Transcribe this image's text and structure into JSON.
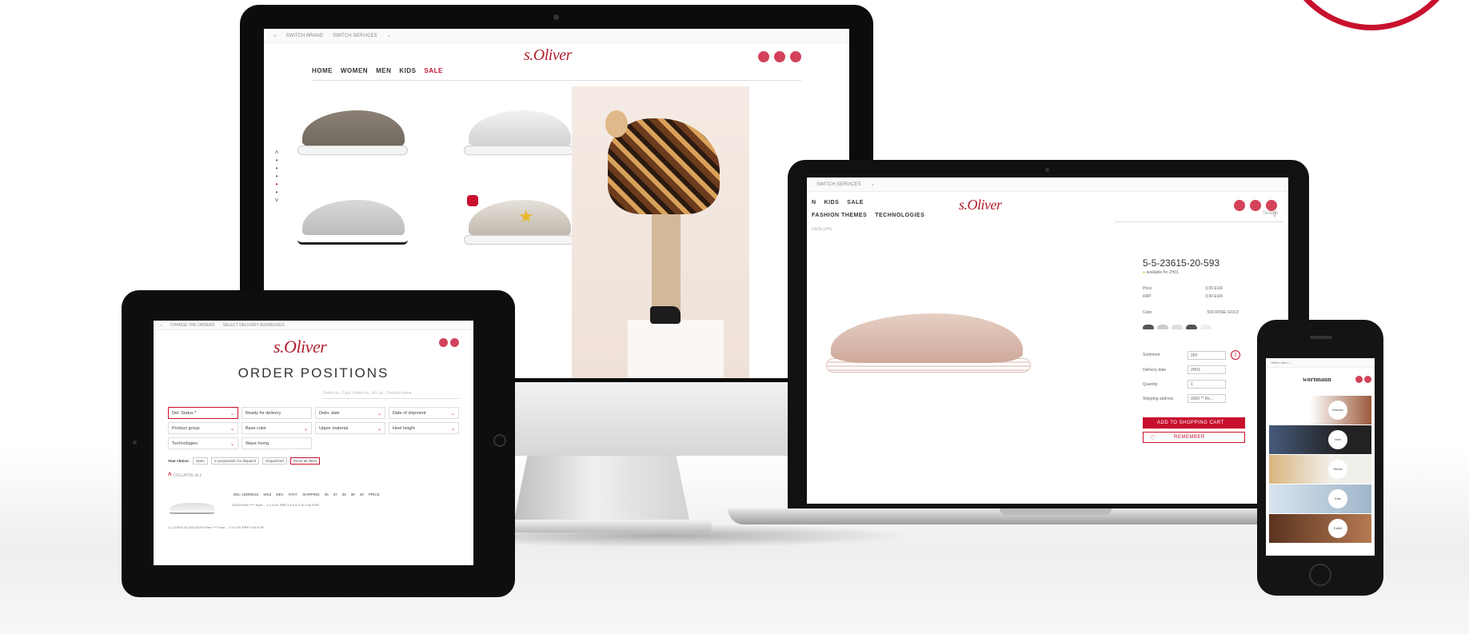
{
  "desktop": {
    "topbar": {
      "home_icon": "home-icon",
      "links": [
        "SWITCH BRAND",
        "SWITCH SERVICES"
      ]
    },
    "logo": "s.Oliver",
    "nav": [
      "HOME",
      "WOMEN",
      "MEN",
      "KIDS",
      "SALE"
    ],
    "icons": [
      "user-icon",
      "heart-icon",
      "cart-icon"
    ],
    "pager": [
      "˄",
      "•",
      "•",
      "•",
      "•",
      "•",
      "˅"
    ]
  },
  "laptop": {
    "topbar_link": "SWITCH SERVICES",
    "logo": "s.Oliver",
    "nav1": [
      "N",
      "KIDS",
      "SALE"
    ],
    "nav2": [
      "FASHION THEMES",
      "TECHNOLOGIES"
    ],
    "search_placeholder": "Search",
    "breadcrumb": "LACE-UPS",
    "product": {
      "sku": "5-5-23615-20-593",
      "availability": "available for 2H01",
      "price_label": "Price",
      "price_value": "0,00 EUR",
      "rrp_label": "RRP",
      "rrp_value": "0,00 EUR",
      "color_label": "Color",
      "color_value": "593 ROSE GOLD",
      "fields": [
        {
          "label": "Sortiment",
          "value": "2FF"
        },
        {
          "label": "Delivery date",
          "value": "2H01"
        },
        {
          "label": "Quantity",
          "value": "1"
        },
        {
          "label": "Shipping address",
          "value": "0000 ** Re..."
        }
      ],
      "add_to_cart": "ADD TO SHOPPING CART",
      "remember": "REMEMBER",
      "info_icon": "i"
    },
    "accent": "#c8102e"
  },
  "tablet": {
    "topbar": [
      "CHANGE THE ORDERS",
      "SELECT DELIVERY ADDRESSES"
    ],
    "logo": "s.Oliver",
    "title": "ORDER POSITIONS",
    "search_placeholder": "Order no., Cust. Order no., Art. no., Product name",
    "filters": [
      {
        "label": "Del. Status *",
        "highlight": true
      },
      {
        "label": "Ready for delivery"
      },
      {
        "label": "Deliv. date"
      },
      {
        "label": "Date of shipment"
      },
      {
        "label": "Product group"
      },
      {
        "label": "Base color"
      },
      {
        "label": "Upper material"
      },
      {
        "label": "Heel height"
      },
      {
        "label": "Technologies"
      },
      {
        "label": "Wave hemg"
      }
    ],
    "chips_label": "Your choice:",
    "chips": [
      "Open",
      "In preparation for dispatch",
      "Dispatched",
      "Reset all filters"
    ],
    "collapse_all": "COLLAPSE ALL",
    "columns": [
      "DEL ADDRESS",
      "WKZ",
      "DEV",
      "STAT.",
      "SHIPPING",
      "36",
      "37",
      "38",
      "39",
      "40",
      "PRICE"
    ],
    "rows": [
      {
        "text": "D2004 Plan **** Tope ... 2 x D.W. RRP 4 5 5 5 5 40 0,00 EUR"
      },
      {
        "text": "1-1-32519-20-200 D2004 Plan **** Tope ... 2 x D.W. RRP 0,00 EUR"
      }
    ]
  },
  "phone": {
    "topbar": "Offline Menu",
    "brand": "wortmann",
    "categories": [
      "Woman",
      "Man",
      "Shoes",
      "Kids",
      "Outlet"
    ]
  }
}
